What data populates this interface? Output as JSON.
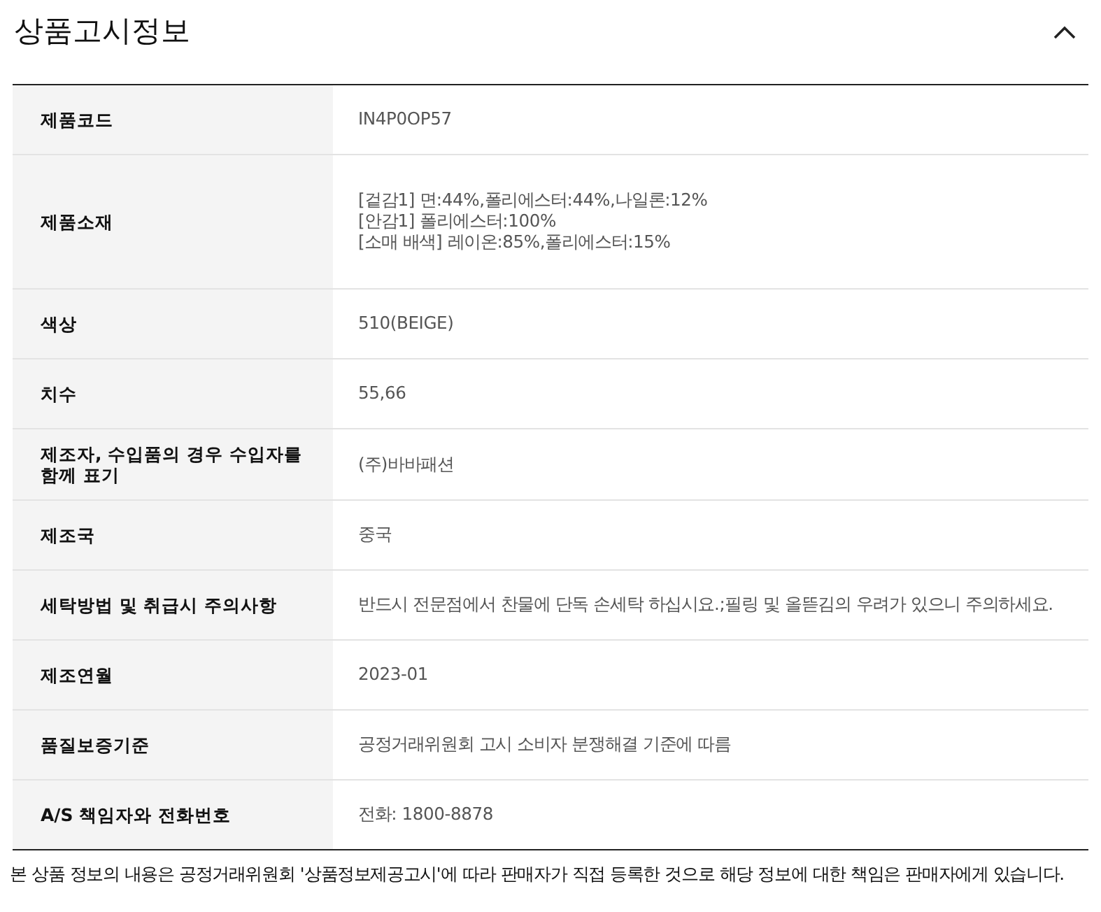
{
  "section": {
    "title": "상품고시정보",
    "expanded": true
  },
  "rows": [
    {
      "label": "제품코드",
      "value": [
        "IN4P0OP57"
      ]
    },
    {
      "label": "제품소재",
      "value": [
        "[겉감1] 면:44%,폴리에스터:44%,나일론:12%",
        "[안감1] 폴리에스터:100%",
        "[소매 배색] 레이온:85%,폴리에스터:15%"
      ]
    },
    {
      "label": "색상",
      "value": [
        "510(BEIGE)"
      ]
    },
    {
      "label": "치수",
      "value": [
        "55,66"
      ]
    },
    {
      "label": "제조자, 수입품의 경우 수입자를 함께 표기",
      "value": [
        "(주)바바패션"
      ]
    },
    {
      "label": "제조국",
      "value": [
        "중국"
      ]
    },
    {
      "label": "세탁방법 및 취급시 주의사항",
      "value": [
        "반드시 전문점에서 찬물에 단독 손세탁 하십시요.;필링 및 올뜯김의 우려가 있으니 주의하세요."
      ]
    },
    {
      "label": "제조연월",
      "value": [
        "2023-01"
      ]
    },
    {
      "label": "품질보증기준",
      "value": [
        "공정거래위원회 고시 소비자 분쟁해결 기준에 따름"
      ]
    },
    {
      "label": "A/S 책임자와 전화번호",
      "value": [
        "전화: 1800-8878"
      ]
    }
  ],
  "notice": "본 상품 정보의 내용은 공정거래위원회 '상품정보제공고시'에 따라 판매자가 직접 등록한 것으로 해당 정보에 대한 책임은 판매자에게 있습니다."
}
